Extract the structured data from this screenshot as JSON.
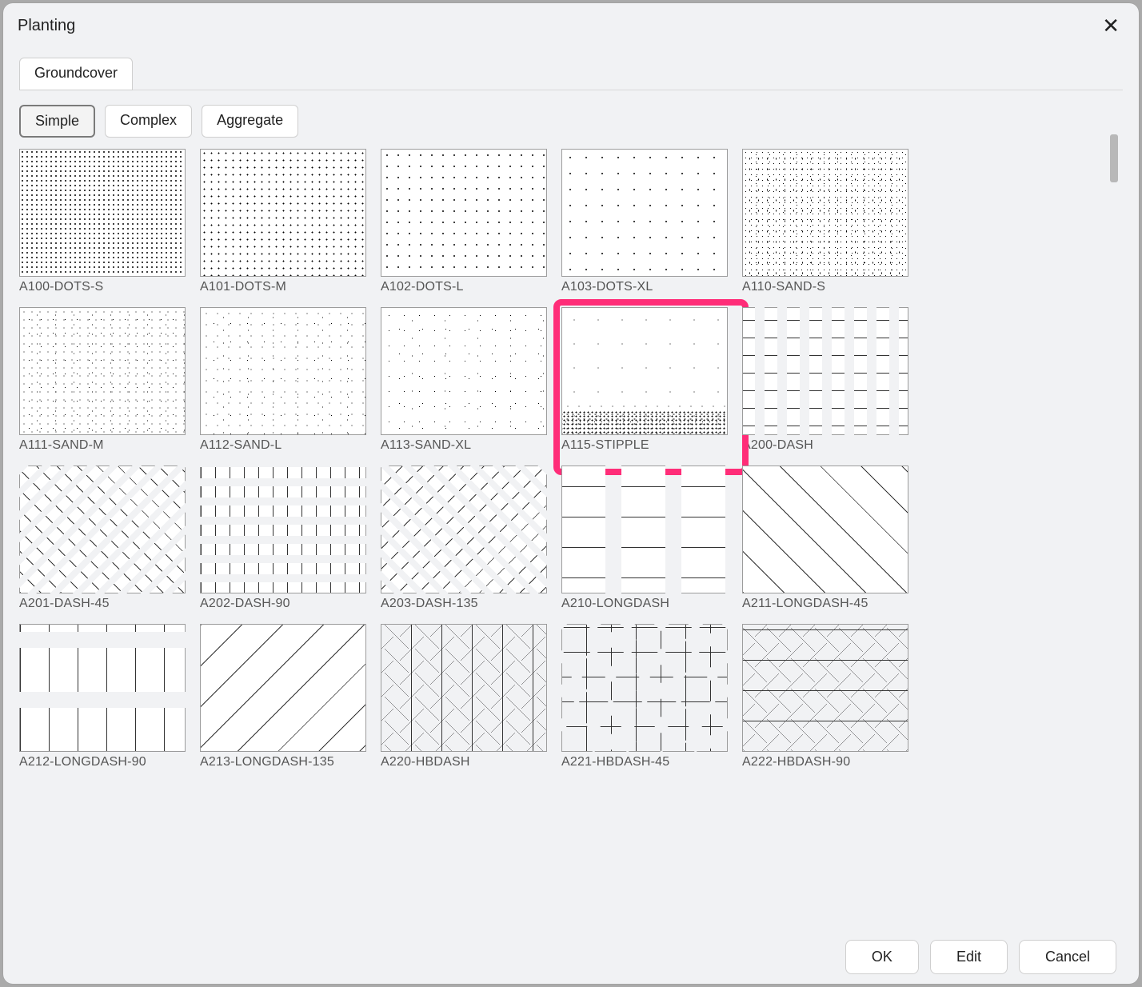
{
  "title": "Planting",
  "tab": "Groundcover",
  "filters": {
    "simple": "Simple",
    "complex": "Complex",
    "aggregate": "Aggregate"
  },
  "active_filter": "simple",
  "highlighted": 8,
  "patterns": [
    {
      "id": "A100-DOTS-S",
      "cls": "pat-dots-s"
    },
    {
      "id": "A101-DOTS-M",
      "cls": "pat-dots-m"
    },
    {
      "id": "A102-DOTS-L",
      "cls": "pat-dots-l"
    },
    {
      "id": "A103-DOTS-XL",
      "cls": "pat-dots-xl"
    },
    {
      "id": "A110-SAND-S",
      "cls": "pat-sand-s"
    },
    {
      "id": "A111-SAND-M",
      "cls": "pat-sand-m"
    },
    {
      "id": "A112-SAND-L",
      "cls": "pat-sand-l"
    },
    {
      "id": "A113-SAND-XL",
      "cls": "pat-sand-xl"
    },
    {
      "id": "A115-STIPPLE",
      "cls": "pat-stipple"
    },
    {
      "id": "A200-DASH",
      "cls": "pat-dash-0"
    },
    {
      "id": "A201-DASH-45",
      "cls": "pat-dash-45"
    },
    {
      "id": "A202-DASH-90",
      "cls": "pat-dash-90"
    },
    {
      "id": "A203-DASH-135",
      "cls": "pat-dash-135"
    },
    {
      "id": "A210-LONGDASH",
      "cls": "pat-longdash-0"
    },
    {
      "id": "A211-LONGDASH-45",
      "cls": "pat-longdash-45"
    },
    {
      "id": "A212-LONGDASH-90",
      "cls": "pat-longdash-90"
    },
    {
      "id": "A213-LONGDASH-135",
      "cls": "pat-longdash-135"
    },
    {
      "id": "A220-HBDASH",
      "cls": "pat-hb-0"
    },
    {
      "id": "A221-HBDASH-45",
      "cls": "pat-hb-45"
    },
    {
      "id": "A222-HBDASH-90",
      "cls": "pat-hb-90"
    }
  ],
  "buttons": {
    "ok": "OK",
    "edit": "Edit",
    "cancel": "Cancel"
  }
}
